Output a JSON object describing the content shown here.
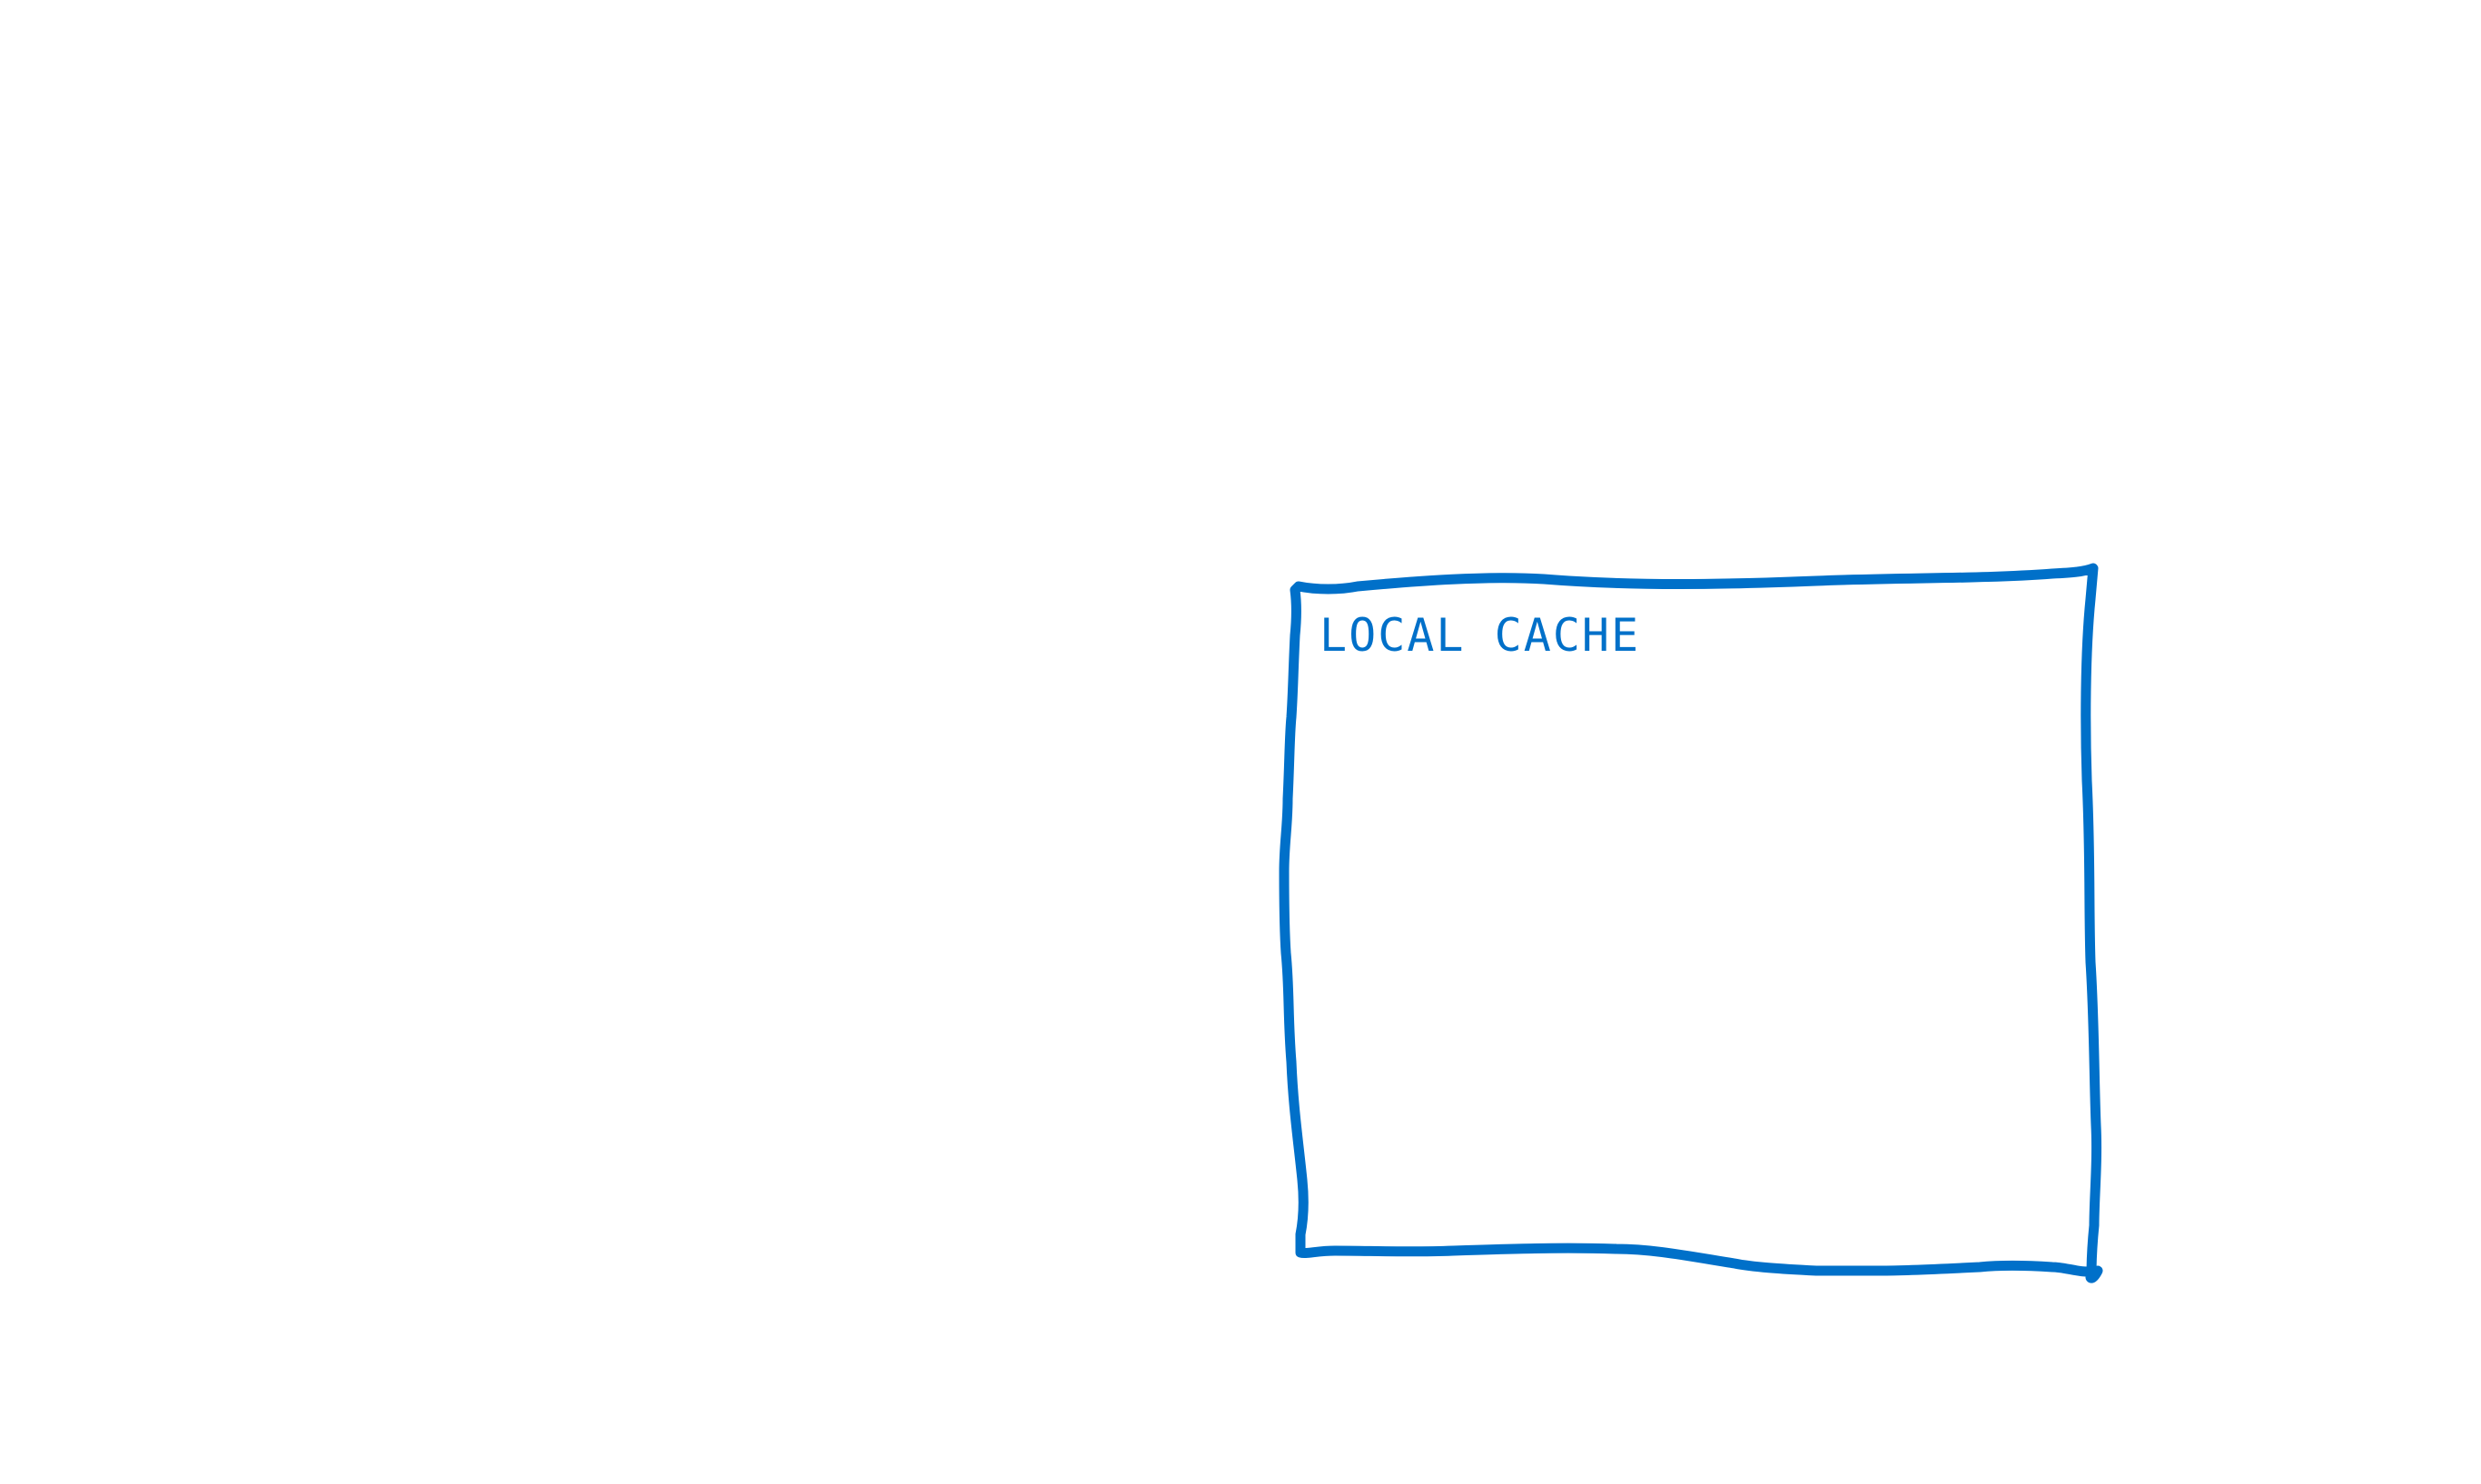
{
  "diagram": {
    "background": "#ffffff",
    "stroke_color": "#0070c9",
    "nodes": [
      {
        "id": "local-cache",
        "label": "LOCAL CACHE",
        "shape": "hand-drawn-rectangle"
      }
    ]
  }
}
